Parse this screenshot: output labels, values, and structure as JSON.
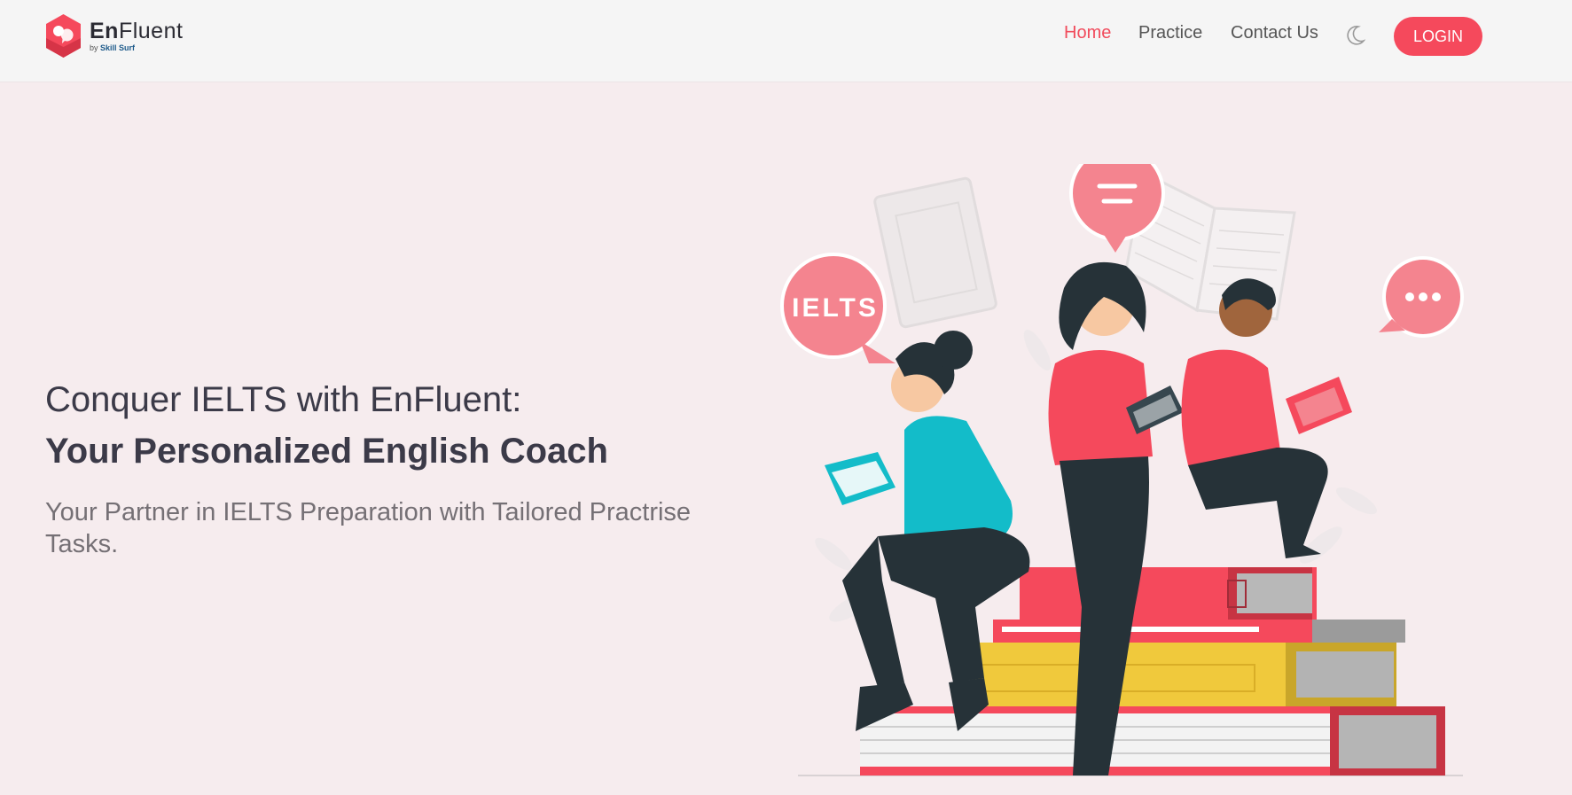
{
  "brand": {
    "name_bold": "En",
    "name_rest": "Fluent",
    "sub_prefix": "by ",
    "sub_brand": "Skill Surf",
    "accent": "#f5495c"
  },
  "nav": {
    "items": [
      {
        "label": "Home",
        "active": true
      },
      {
        "label": "Practice",
        "active": false
      },
      {
        "label": "Contact Us",
        "active": false
      }
    ],
    "theme_toggle_icon": "moon-icon",
    "login_label": "LOGIN"
  },
  "hero": {
    "title_line1": "Conquer IELTS with EnFluent:",
    "title_line2": "Your Personalized English Coach",
    "subtitle": "Your Partner in IELTS Preparation with Tailored Practrise Tasks."
  },
  "illustration": {
    "bubble_ielts": "IELTS"
  }
}
